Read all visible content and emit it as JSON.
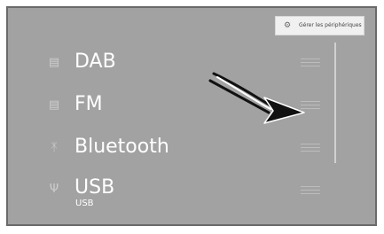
{
  "sources": [
    {
      "label": "DAB",
      "icon": "radio-icon"
    },
    {
      "label": "FM",
      "icon": "radio-icon"
    },
    {
      "label": "Bluetooth",
      "icon": "bluetooth-icon"
    },
    {
      "label": "USB",
      "icon": "usb-icon",
      "sub": "USB"
    }
  ],
  "popup": {
    "label": "Gérer les périphériques",
    "icon": "gear-icon"
  },
  "colors": {
    "screen": "#a2a2a2",
    "text": "#ffffff",
    "arrow": "#111111"
  }
}
